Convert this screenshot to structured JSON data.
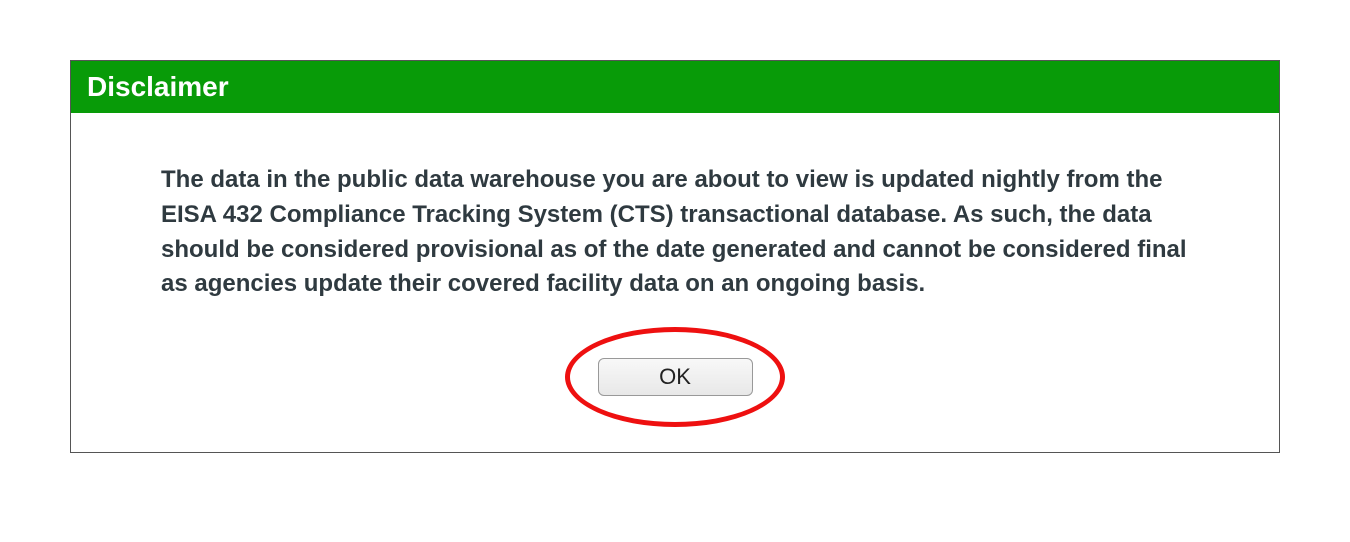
{
  "dialog": {
    "title": "Disclaimer",
    "body": "The data in the public data warehouse you are about to view is updated nightly from the EISA 432 Compliance Tracking System (CTS) transactional database. As such, the data should be considered provisional as of the date generated and cannot be considered final as agencies update their covered facility data on an ongoing basis.",
    "ok_label": "OK"
  }
}
